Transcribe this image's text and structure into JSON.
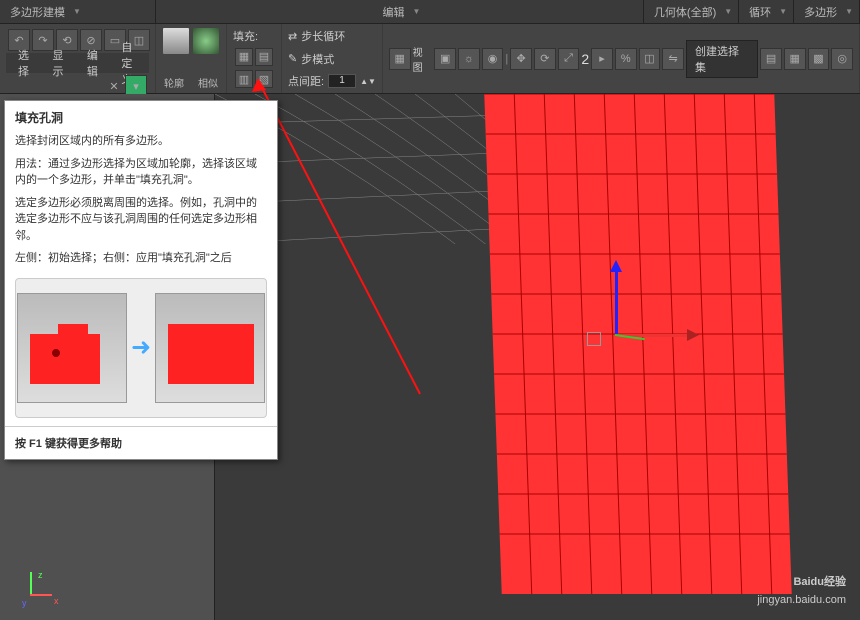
{
  "topmenu": {
    "left_label": "多边形建模",
    "center_label": "编辑",
    "geom_label": "几何体(全部)",
    "loop_label": "循环",
    "poly_label": "多边形"
  },
  "subtabs": {
    "t1": "选择",
    "t2": "显示",
    "t3": "编辑",
    "t4": "自定义"
  },
  "ribbon": {
    "grp1_label": "轮廓",
    "grp2_label": "相似",
    "fill_label": "填充:",
    "step_grow": "步长循环",
    "step_mode": "步模式",
    "point_dist": "点间距:",
    "point_val": "1",
    "view_label": "视图",
    "perspective": "2",
    "create_sel": "创建选择集"
  },
  "tooltip": {
    "title": "填充孔洞",
    "p1": "选择封闭区域内的所有多边形。",
    "p2": "用法：通过多边形选择为区域加轮廓，选择该区域内的一个多边形，并单击\"填充孔洞\"。",
    "p3": "选定多边形必须脱离周围的选择。例如，孔洞中的选定多边形不应与该孔洞周围的任何选定多边形相邻。",
    "p4": "左侧：初始选择；右侧：应用\"填充孔洞\"之后",
    "footer": "按 F1 键获得更多帮助"
  },
  "watermark": {
    "brand": "Baidu经验",
    "url": "jingyan.baidu.com"
  },
  "axes": {
    "x": "x",
    "y": "y",
    "z": "z"
  }
}
